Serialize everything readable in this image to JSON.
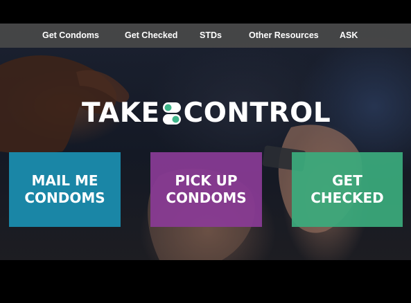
{
  "nav": {
    "items": [
      {
        "label": "Get Condoms"
      },
      {
        "label": "Get Checked"
      },
      {
        "label": "STDs"
      },
      {
        "label": "Other Resources"
      },
      {
        "label": "ASK"
      }
    ]
  },
  "logo": {
    "left_text": "TAKE",
    "right_text": "CONTROL",
    "mark_icon": "toggle-switch-icon"
  },
  "tiles": [
    {
      "line1": "MAIL ME",
      "line2": "CONDOMS",
      "color": "#1a86a6"
    },
    {
      "line1": "PICK UP",
      "line2": "CONDOMS",
      "color": "#8a3b96"
    },
    {
      "line1": "GET",
      "line2": "CHECKED",
      "color": "#3bab7d"
    }
  ],
  "colors": {
    "logo_mark_green": "#3fb58a",
    "navbar": "#484848"
  }
}
